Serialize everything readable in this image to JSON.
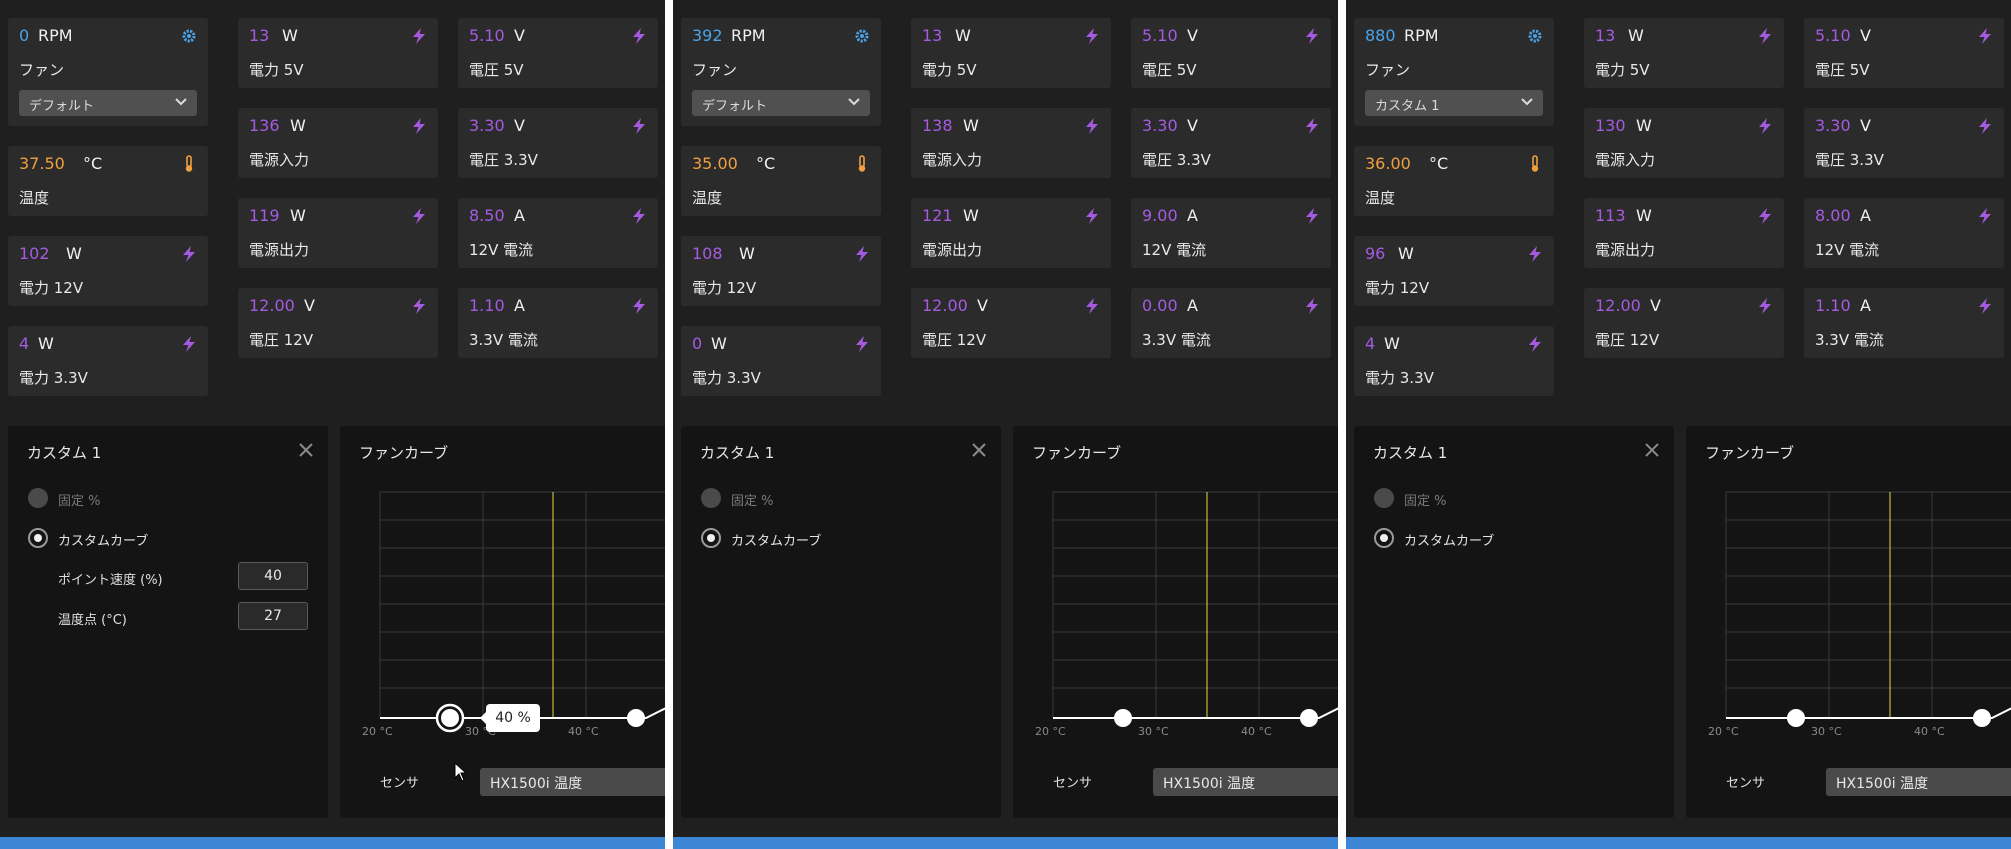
{
  "labels": {
    "fan": "ファン",
    "temp": "温度",
    "p12": "電力 12V",
    "p33": "電力 3.3V",
    "p5": "電力 5V",
    "pin": "電源入力",
    "pout": "電源出力",
    "v12": "電圧 12V",
    "v5": "電圧 5V",
    "v33": "電圧 3.3V",
    "a12": "12V 電流",
    "a33": "3.3V 電流"
  },
  "units": {
    "rpm": "RPM",
    "w": "W",
    "c": "°C",
    "v": "V",
    "a": "A"
  },
  "card": {
    "title": "カスタム 1",
    "fixed_label": "固定 %",
    "curve_label": "カスタムカーブ",
    "point_speed_label": "ポイント速度 (%)",
    "temp_point_label": "温度点 (°C)"
  },
  "curve": {
    "title": "ファンカーブ",
    "x_ticks": [
      "20 °C",
      "30 °C",
      "40 °C"
    ],
    "sensor_label": "センサ",
    "sensor_value": "HX1500i 温度",
    "tooltip": "40 %"
  },
  "colors": {
    "accent": "#3d86d6",
    "purple": "#a55be0",
    "orange": "#f0a040",
    "blue": "#4aa3e8"
  },
  "panels": [
    {
      "rpm": "0",
      "mode": "デフォルト",
      "temp": "37.50",
      "p12": "102",
      "p33": "4",
      "p5": "13",
      "pin": "136",
      "pout": "119",
      "v12": "12.00",
      "v5": "5.10",
      "v33": "3.30",
      "a12": "8.50",
      "a33": "1.10",
      "point_speed": "40",
      "temp_point": "27"
    },
    {
      "rpm": "392",
      "mode": "デフォルト",
      "temp": "35.00",
      "p12": "108",
      "p33": "0",
      "p5": "13",
      "pin": "138",
      "pout": "121",
      "v12": "12.00",
      "v5": "5.10",
      "v33": "3.30",
      "a12": "9.00",
      "a33": "0.00"
    },
    {
      "rpm": "880",
      "mode": "カスタム 1",
      "temp": "36.00",
      "p12": "96",
      "p33": "4",
      "p5": "13",
      "pin": "130",
      "pout": "113",
      "v12": "12.00",
      "v5": "5.10",
      "v33": "3.30",
      "a12": "8.00",
      "a33": "1.10"
    }
  ]
}
